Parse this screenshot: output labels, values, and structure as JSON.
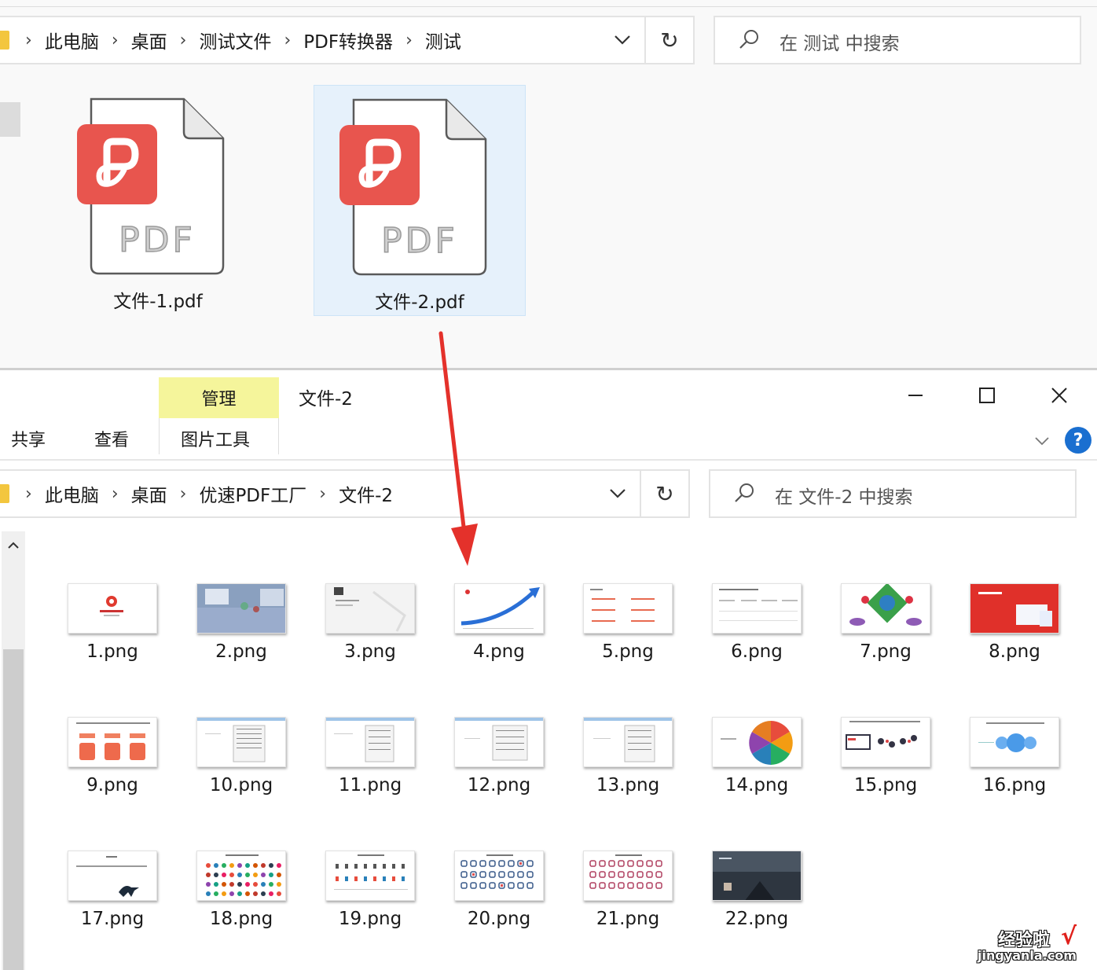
{
  "top_window": {
    "breadcrumb": [
      "此电脑",
      "桌面",
      "测试文件",
      "PDF转换器",
      "测试"
    ],
    "search_placeholder": "在 测试 中搜索",
    "files": [
      {
        "name": "文件-1.pdf",
        "icon_text": "PDF",
        "selected": false
      },
      {
        "name": "文件-2.pdf",
        "icon_text": "PDF",
        "selected": true
      }
    ]
  },
  "bottom_window": {
    "contextual_tab": "管理",
    "title": "文件-2",
    "ribbon_tabs": [
      "共享",
      "查看"
    ],
    "contextual_subtab": "图片工具",
    "help_label": "?",
    "breadcrumb": [
      "此电脑",
      "桌面",
      "优速PDF工厂",
      "文件-2"
    ],
    "search_placeholder": "在 文件-2 中搜索",
    "files": [
      "1.png",
      "2.png",
      "3.png",
      "4.png",
      "5.png",
      "6.png",
      "7.png",
      "8.png",
      "9.png",
      "10.png",
      "11.png",
      "12.png",
      "13.png",
      "14.png",
      "15.png",
      "16.png",
      "17.png",
      "18.png",
      "19.png",
      "20.png",
      "21.png",
      "22.png"
    ]
  },
  "watermark": {
    "text": "经验啦",
    "check": "√",
    "url": "jingyanla.com"
  },
  "colors": {
    "pdf_red": "#e8554e",
    "selection": "#e6f1fb",
    "context_tab": "#f5f59b",
    "arrow": "#e4312b",
    "help_blue": "#1a6fd0"
  }
}
